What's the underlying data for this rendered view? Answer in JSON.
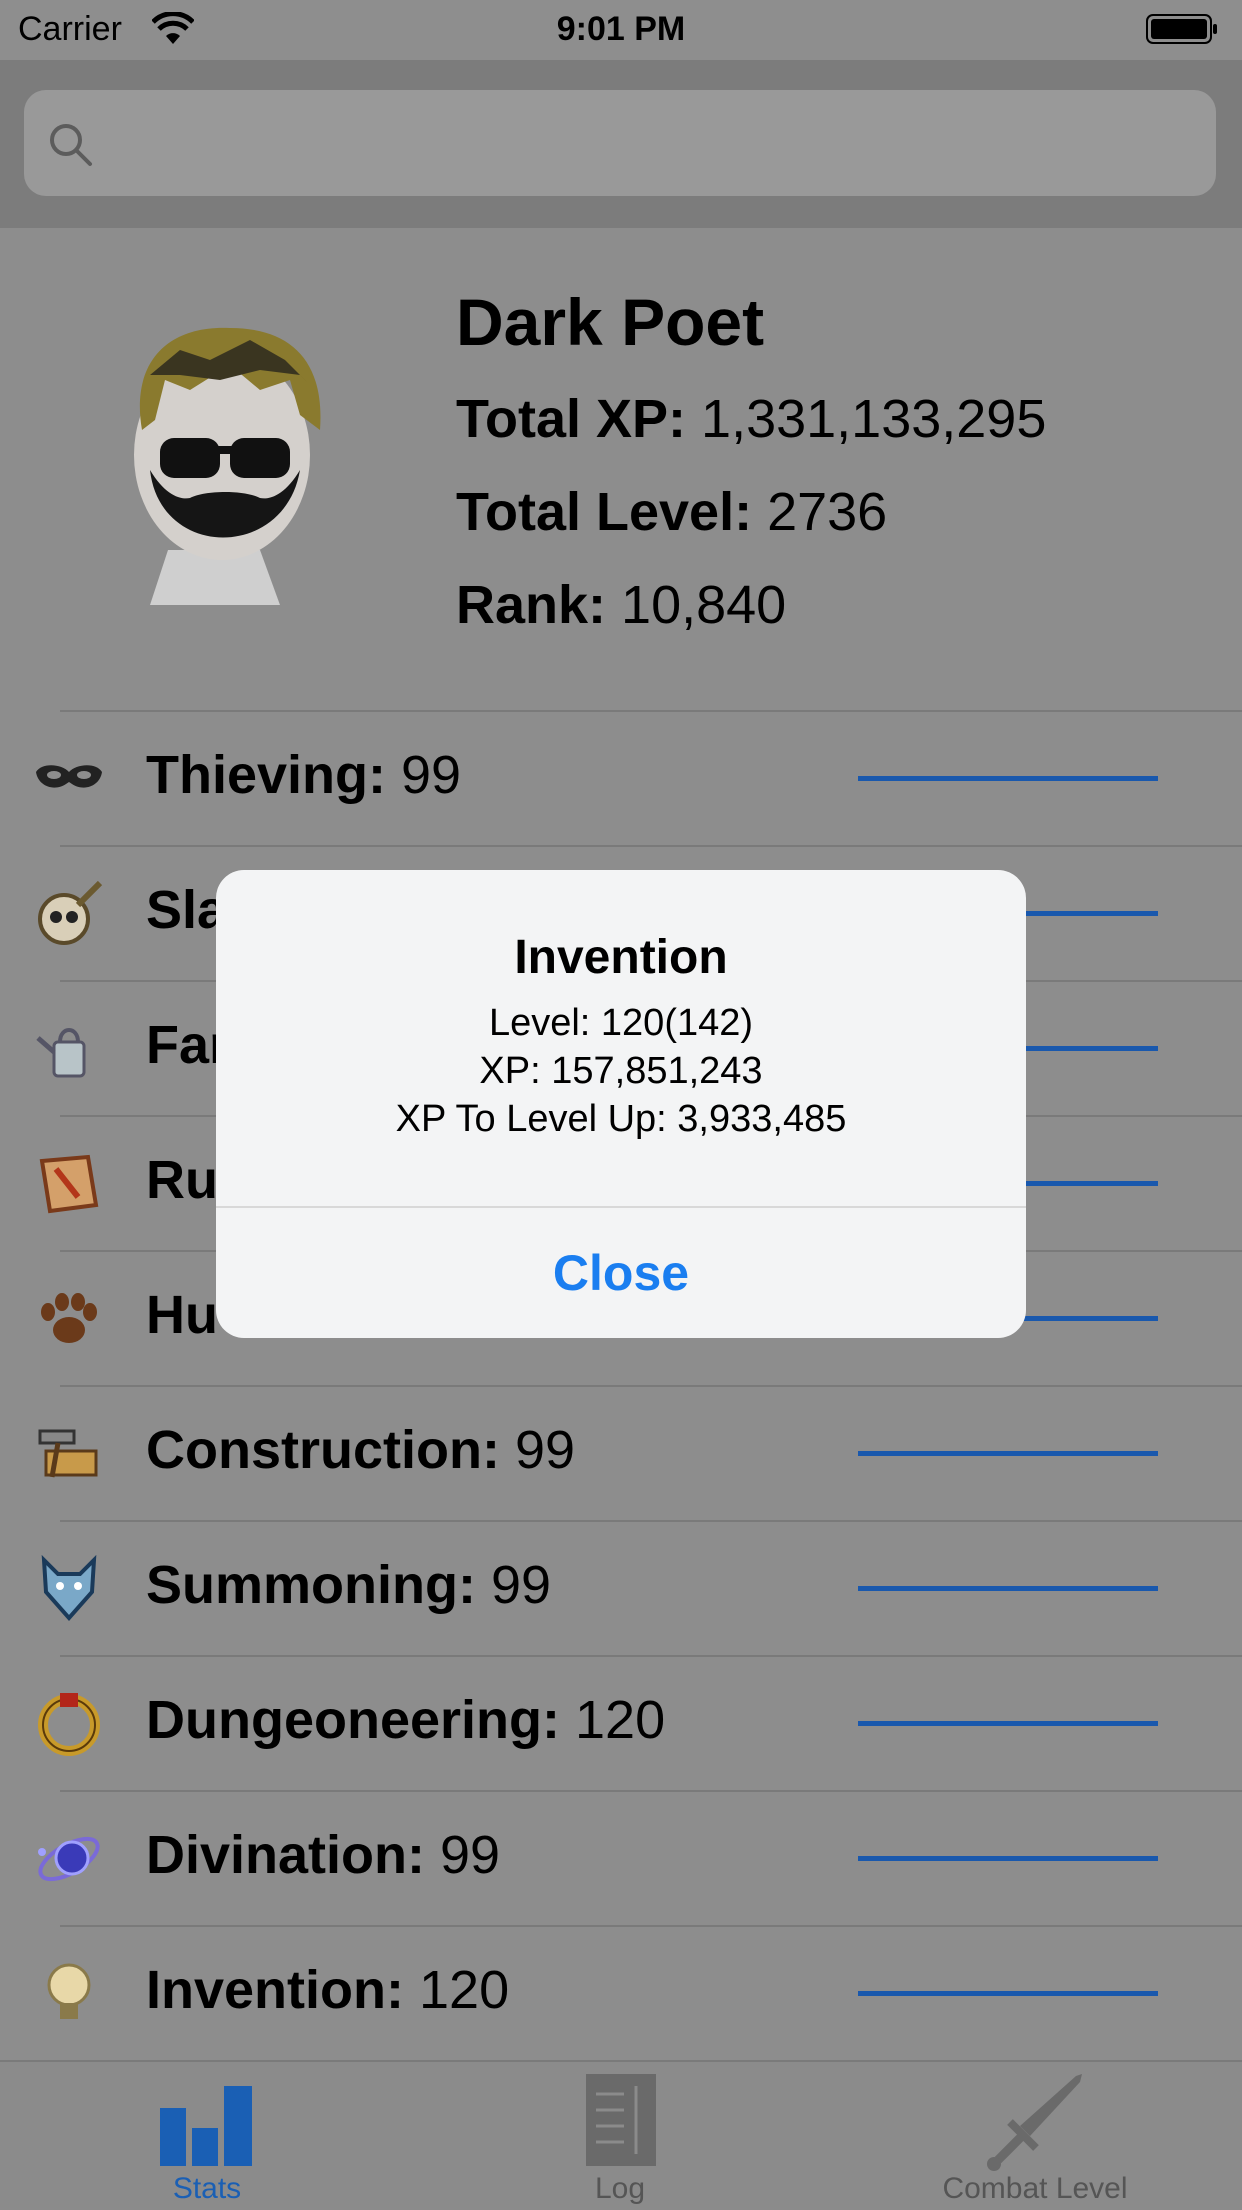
{
  "status_bar": {
    "carrier": "Carrier",
    "time": "9:01 PM"
  },
  "search": {
    "placeholder": ""
  },
  "profile": {
    "name": "Dark Poet",
    "total_xp_label": "Total XP:",
    "total_xp": "1,331,133,295",
    "total_level_label": "Total Level:",
    "total_level": "2736",
    "rank_label": "Rank:",
    "rank": "10,840"
  },
  "skills": [
    {
      "name": "Thieving:",
      "level": "99",
      "icon": "mask-icon"
    },
    {
      "name": "Sla",
      "level": "",
      "icon": "skull-icon"
    },
    {
      "name": "Far",
      "level": "",
      "icon": "watering-can-icon"
    },
    {
      "name": "Ru",
      "level": "",
      "icon": "rune-icon"
    },
    {
      "name": "Hu",
      "level": "",
      "icon": "paw-icon"
    },
    {
      "name": "Construction:",
      "level": "99",
      "icon": "hammer-saw-icon"
    },
    {
      "name": "Summoning:",
      "level": "99",
      "icon": "wolf-icon"
    },
    {
      "name": "Dungeoneering:",
      "level": "120",
      "icon": "ring-icon"
    },
    {
      "name": "Divination:",
      "level": "99",
      "icon": "orb-icon"
    },
    {
      "name": "Invention:",
      "level": "120",
      "icon": "lightbulb-icon"
    }
  ],
  "alert": {
    "title": "Invention",
    "level_line": "Level: 120(142)",
    "xp_line": "XP: 157,851,243",
    "xp_to_level_line": "XP To Level Up: 3,933,485",
    "button": "Close"
  },
  "tabs": [
    {
      "label": "Stats",
      "icon": "bar-chart-icon",
      "selected": true
    },
    {
      "label": "Log",
      "icon": "log-icon",
      "selected": false
    },
    {
      "label": "Combat Level",
      "icon": "sword-icon",
      "selected": false
    }
  ],
  "colors": {
    "accent": "#1a7ef0",
    "tab_selected": "#1a5fb4",
    "bar": "#1958ad"
  }
}
